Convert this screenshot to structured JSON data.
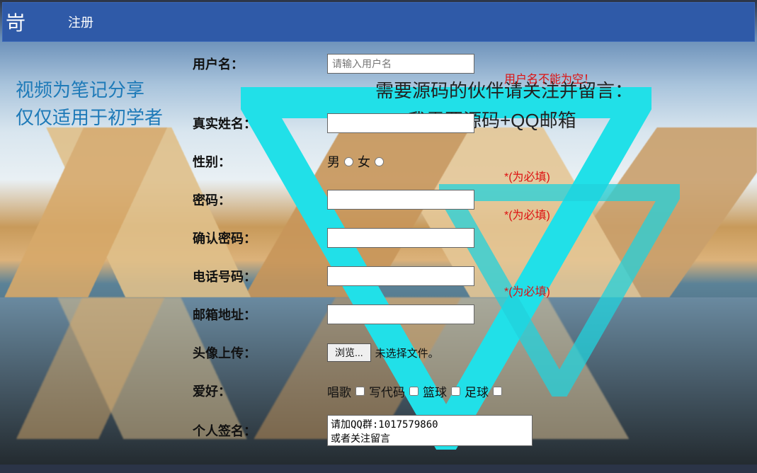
{
  "nav": {
    "logo": "岢",
    "register": "注册"
  },
  "leftnote": {
    "l1": "视频为笔记分享",
    "l2": "仅仅适用于初学者"
  },
  "bignote": {
    "l1": "需要源码的伙伴请关注并留言：",
    "l2": "我需要源码+QQ邮箱"
  },
  "form": {
    "username_label": "用户名：",
    "username_placeholder": "请输入用户名",
    "username_error": "用户名不能为空！",
    "realname_label": "真实姓名：",
    "gender_label": "性别：",
    "gender_male": "男",
    "gender_female": "女",
    "password_label": "密码：",
    "password_required": "*(为必填)",
    "confirm_label": "确认密码：",
    "confirm_required": "*(为必填)",
    "phone_label": "电话号码：",
    "email_label": "邮箱地址：",
    "email_required": "*(为必填)",
    "avatar_label": "头像上传：",
    "avatar_browse": "浏览...",
    "avatar_nofile": "未选择文件。",
    "hobby_label": "爱好：",
    "hobby_sing": "唱歌",
    "hobby_code": "写代码",
    "hobby_basketball": "篮球",
    "hobby_football": "足球",
    "sig_label": "个人签名：",
    "sig_text": "请加QQ群:1017579860\n或者关注留言"
  }
}
